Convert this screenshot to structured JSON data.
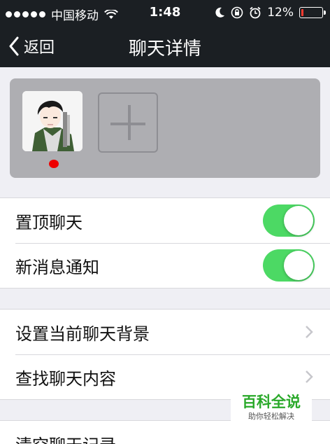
{
  "status_bar": {
    "carrier": "中国移动",
    "time": "1:48",
    "battery_text": "12%",
    "battery_level": 0.12,
    "icons": [
      "signal-dots-icon",
      "wifi-icon",
      "moon-icon",
      "rotation-lock-icon",
      "alarm-icon",
      "battery-icon"
    ]
  },
  "nav": {
    "back_label": "返回",
    "title": "聊天详情"
  },
  "members": {
    "add_icon": "plus-icon"
  },
  "settings_group_1": [
    {
      "label": "置顶聊天",
      "on": true
    },
    {
      "label": "新消息通知",
      "on": true
    }
  ],
  "settings_group_2": [
    {
      "label": "设置当前聊天背景"
    },
    {
      "label": "查找聊天内容"
    }
  ],
  "settings_group_3": [
    {
      "label": "清空聊天记录"
    }
  ],
  "watermark": {
    "main": "百科全说",
    "sub": "助你轻松解决"
  },
  "colors": {
    "toggle_on": "#4cd964",
    "nav_bg": "#1b1f23",
    "battery_low": "#ff3b30",
    "watermark_green": "#2aa92a"
  }
}
